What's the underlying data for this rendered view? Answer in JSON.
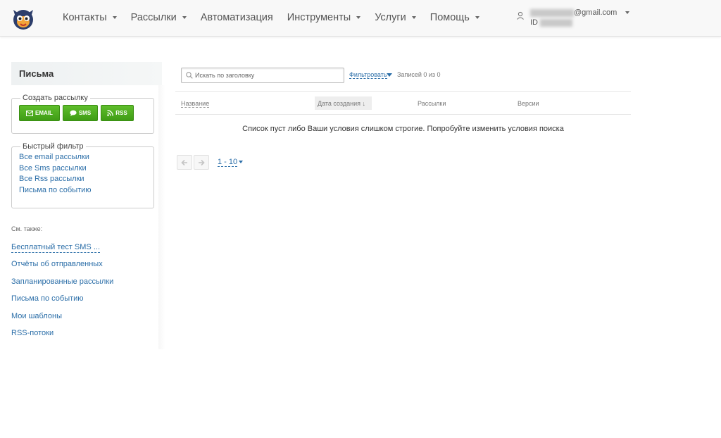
{
  "nav": {
    "items": [
      {
        "label": "Контакты",
        "dropdown": true
      },
      {
        "label": "Рассылки",
        "dropdown": true
      },
      {
        "label": "Автоматизация",
        "dropdown": false
      },
      {
        "label": "Инструменты",
        "dropdown": true
      },
      {
        "label": "Услуги",
        "dropdown": true
      },
      {
        "label": "Помощь",
        "dropdown": true
      }
    ]
  },
  "user": {
    "email_suffix": "gmail.com",
    "id_prefix": "ID"
  },
  "sidebar": {
    "title": "Письма",
    "create": {
      "legend": "Создать рассылку",
      "buttons": {
        "email": "EMAIL",
        "sms": "SMS",
        "rss": "RSS"
      }
    },
    "quick_filter": {
      "legend": "Быстрый фильтр",
      "links": [
        "Все email рассылки",
        "Все Sms рассылки",
        "Все Rss рассылки",
        "Письма по событию"
      ]
    },
    "see_also": {
      "label": "См. также:",
      "links": [
        "Бесплатный тест SMS ...",
        "Отчёты об отправленных",
        "Запланированные рассылки",
        "Письма по событию",
        "Мои шаблоны",
        "RSS-потоки"
      ]
    }
  },
  "toolbar": {
    "search_placeholder": "Искать по заголовку",
    "filter_label": "Фильтровать",
    "records_text": "Записей 0 из 0"
  },
  "table": {
    "columns": [
      "Название",
      "Дата создания ↓",
      "Рассылки",
      "Версии"
    ],
    "empty_message": "Список пуст либо Ваши условия слишком строгие. Попробуйте изменить условия поиска"
  },
  "pagination": {
    "range": "1 - 10"
  },
  "colors": {
    "accent_link": "#2b6ea8",
    "button_green": "#4aa81d",
    "topbar_bg": "#f8f8f8"
  }
}
